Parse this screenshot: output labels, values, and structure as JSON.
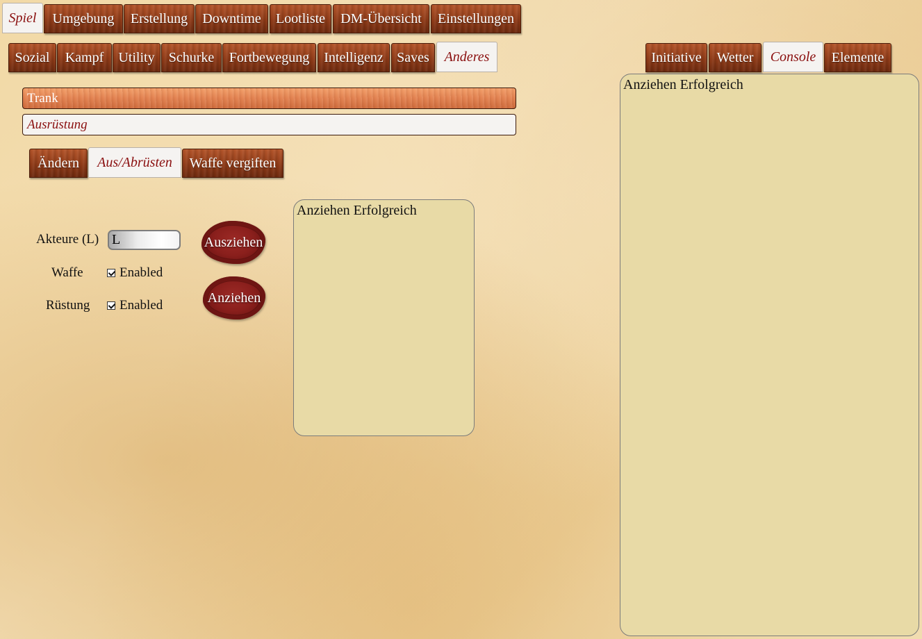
{
  "main_tabs": [
    {
      "label": "Spiel",
      "active": true
    },
    {
      "label": "Umgebung",
      "active": false
    },
    {
      "label": "Erstellung",
      "active": false
    },
    {
      "label": "Downtime",
      "active": false
    },
    {
      "label": "Lootliste",
      "active": false
    },
    {
      "label": "DM-Übersicht",
      "active": false
    },
    {
      "label": "Einstellungen",
      "active": false
    }
  ],
  "category_tabs": [
    {
      "label": "Sozial",
      "active": false
    },
    {
      "label": "Kampf",
      "active": false
    },
    {
      "label": "Utility",
      "active": false
    },
    {
      "label": "Schurke",
      "active": false
    },
    {
      "label": "Fortbewegung",
      "active": false
    },
    {
      "label": "Intelligenz",
      "active": false
    },
    {
      "label": "Saves",
      "active": false
    },
    {
      "label": "Anderes",
      "active": true
    }
  ],
  "right_tabs": [
    {
      "label": "Initiative",
      "active": false
    },
    {
      "label": "Wetter",
      "active": false
    },
    {
      "label": "Console",
      "active": true
    },
    {
      "label": "Elemente",
      "active": false
    }
  ],
  "fields": {
    "trank": "Trank",
    "ausruestung": "Ausrüstung"
  },
  "sub_tabs": [
    {
      "label": "Ändern",
      "active": false
    },
    {
      "label": "Aus/Abrüsten",
      "active": true
    },
    {
      "label": "Waffe vergiften",
      "active": false
    }
  ],
  "form": {
    "akteure_label": "Akteure (L)",
    "akteure_value": "L",
    "waffe_label": "Waffe",
    "waffe_checkbox": "Enabled",
    "waffe_checked": true,
    "ruestung_label": "Rüstung",
    "ruestung_checkbox": "Enabled",
    "ruestung_checked": true
  },
  "buttons": {
    "ausziehen": "Ausziehen",
    "anziehen": "Anziehen"
  },
  "output_panel": {
    "text": "Anziehen Erfolgreich"
  },
  "console_panel": {
    "text": "Anziehen Erfolgreich"
  },
  "colors": {
    "active_tab_text": "#8a0f0f",
    "panel_bg": "#e8daa6",
    "seal": "#8a1f1c"
  }
}
